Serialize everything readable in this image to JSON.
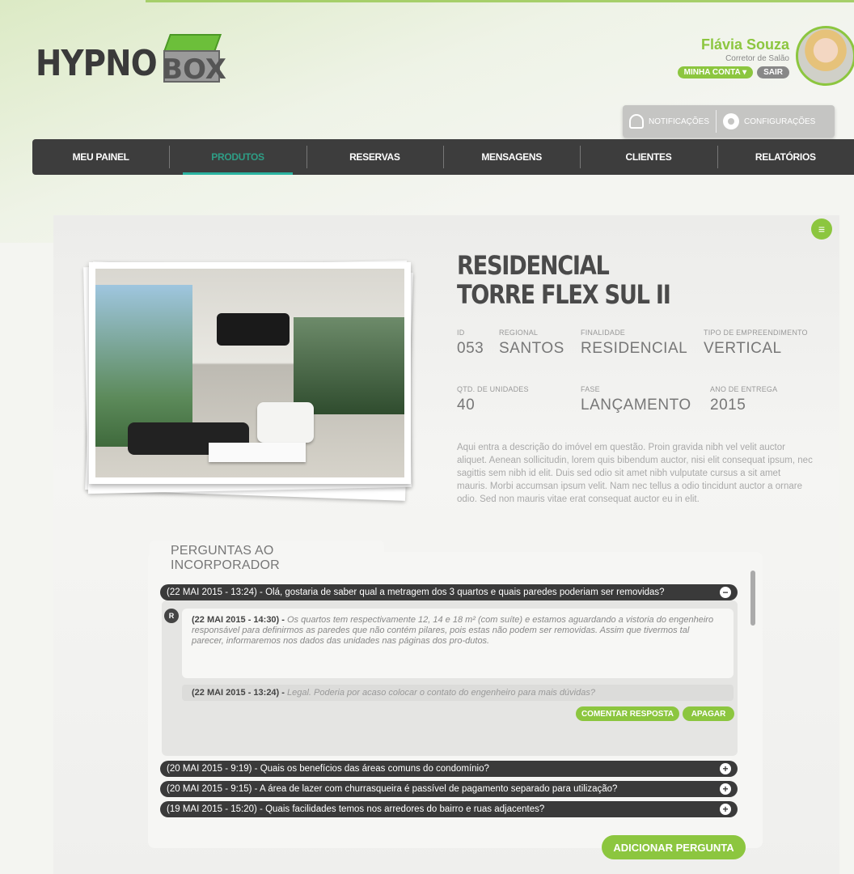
{
  "brand": {
    "logo_text": "HYPNO",
    "logo_box_text": "BOX"
  },
  "user": {
    "name": "Flávia Souza",
    "role": "Corretor de Salão",
    "account_label": "MINHA CONTA ▾",
    "logout_label": "SAIR"
  },
  "utility": {
    "notifications_label": "NOTIFICAÇÕES",
    "settings_label": "CONFIGURAÇÕES"
  },
  "nav": {
    "items": [
      {
        "label": "MEU PAINEL"
      },
      {
        "label": "PRODUTOS"
      },
      {
        "label": "RESERVAS"
      },
      {
        "label": "MENSAGENS"
      },
      {
        "label": "CLIENTES"
      },
      {
        "label": "RELATÓRIOS"
      }
    ],
    "active": "PRODUTOS"
  },
  "product": {
    "title_line1": "RESIDENCIAL",
    "title_line2": "TORRE FLEX SUL II",
    "fields": {
      "id": {
        "label": "ID",
        "value": "053"
      },
      "regional": {
        "label": "REGIONAL",
        "value": "SANTOS"
      },
      "finalidade": {
        "label": "FINALIDADE",
        "value": "RESIDENCIAL"
      },
      "tipo": {
        "label": "TIPO DE EMPREENDIMENTO",
        "value": "VERTICAL"
      },
      "qtd": {
        "label": "QTD. DE UNIDADES",
        "value": "40"
      },
      "fase": {
        "label": "FASE",
        "value": "LANÇAMENTO"
      },
      "ano": {
        "label": "ANO DE ENTREGA",
        "value": "2015"
      }
    },
    "description": "Aqui entra a descrição do imóvel em questão. Proin gravida nibh vel velit auctor aliquet. Aenean sollicitudin, lorem quis bibendum auctor, nisi elit consequat ipsum, nec sagittis sem nibh id elit. Duis sed odio sit amet nibh vulputate cursus a sit amet mauris. Morbi accumsan ipsum velit. Nam nec tellus a odio tincidunt auctor a ornare odio. Sed non  mauris vitae erat consequat auctor eu in elit."
  },
  "qa": {
    "section_title": "PERGUNTAS AO INCORPORADOR",
    "open_question": "(22 MAI 2015 - 13:24) - Olá, gostaria de saber qual a metragem dos 3 quartos e quais paredes poderiam ser removidas?",
    "answer_badge": "R",
    "answer_meta": "(22 MAI 2015 - 14:30) - ",
    "answer_text": "Os quartos tem respectivamente 12, 14 e 18 m² (com suíte) e estamos aguardando a vistoria do engenheiro responsável para definirmos as paredes que não contém pilares, pois estas não podem ser removidas. Assim que tivermos tal  parecer, informaremos nos dados das unidades nas páginas dos pro-dutos.",
    "reply_meta": "(22 MAI 2015 - 13:24) - ",
    "reply_text": "Legal. Poderia por acaso colocar o contato do engenheiro para mais dúvidas?",
    "comment_label": "COMENTAR RESPOSTA",
    "delete_label": "APAGAR",
    "collapsed_questions": [
      "(20 MAI 2015 - 9:19) - Quais os benefícios das áreas comuns do condomínio?",
      "(20 MAI 2015 - 9:15) - A área de lazer com churrasqueira é passível de pagamento separado para utilização?",
      "(19 MAI 2015 - 15:20) - Quais facilidades temos nos arredores do bairro e ruas adjacentes?"
    ],
    "add_label": "ADICIONAR PERGUNTA"
  }
}
